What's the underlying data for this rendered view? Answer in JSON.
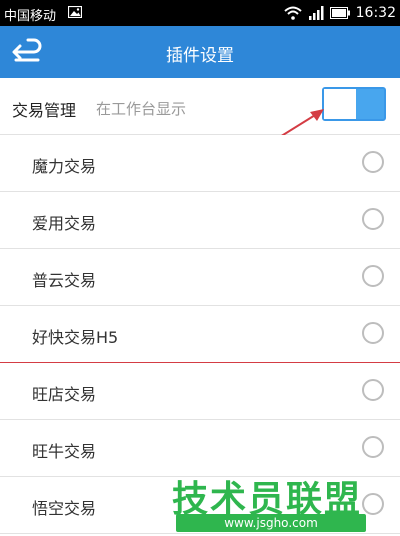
{
  "status_bar": {
    "carrier": "中国移动",
    "time": "16:32"
  },
  "title_bar": {
    "title": "插件设置",
    "back_icon": "back-arrow-icon",
    "background": "#2e87d8"
  },
  "header_row": {
    "label": "交易管理",
    "hint": "在工作台显示",
    "toggle_on": true
  },
  "plugins": [
    {
      "label": "魔力交易",
      "selected": false
    },
    {
      "label": "爱用交易",
      "selected": false
    },
    {
      "label": "普云交易",
      "selected": false
    },
    {
      "label": "好快交易H5",
      "selected": false
    },
    {
      "label": "旺店交易",
      "selected": false
    },
    {
      "label": "旺牛交易",
      "selected": false
    },
    {
      "label": "悟空交易",
      "selected": false
    }
  ],
  "watermark": {
    "main": "技术员联盟",
    "url": "www.jsgho.com"
  }
}
